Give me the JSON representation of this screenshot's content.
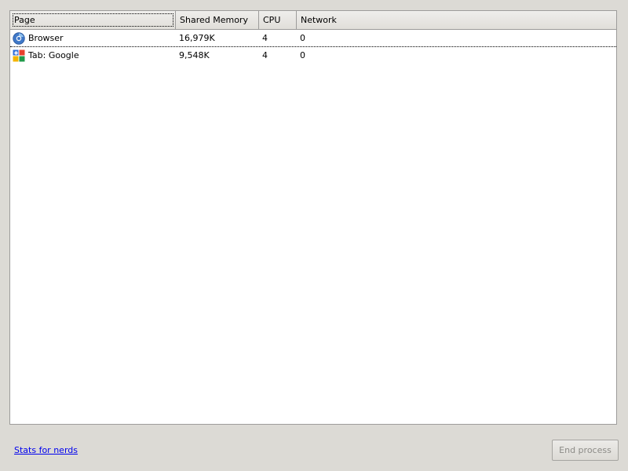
{
  "table": {
    "columns": {
      "page": "Page",
      "shared_memory": "Shared Memory",
      "cpu": "CPU",
      "network": "Network"
    },
    "rows": [
      {
        "icon": "browser-icon",
        "page": "Browser",
        "shared_memory": "16,979K",
        "cpu": "4",
        "network": "0"
      },
      {
        "icon": "google-icon",
        "page": "Tab: Google",
        "shared_memory": "9,548K",
        "cpu": "4",
        "network": "0"
      }
    ]
  },
  "footer": {
    "stats_link": "Stats for nerds",
    "end_process_button": "End process"
  },
  "colors": {
    "window_bg": "#dcdad5",
    "link": "#0000ee",
    "disabled_text": "#8c8b87"
  }
}
